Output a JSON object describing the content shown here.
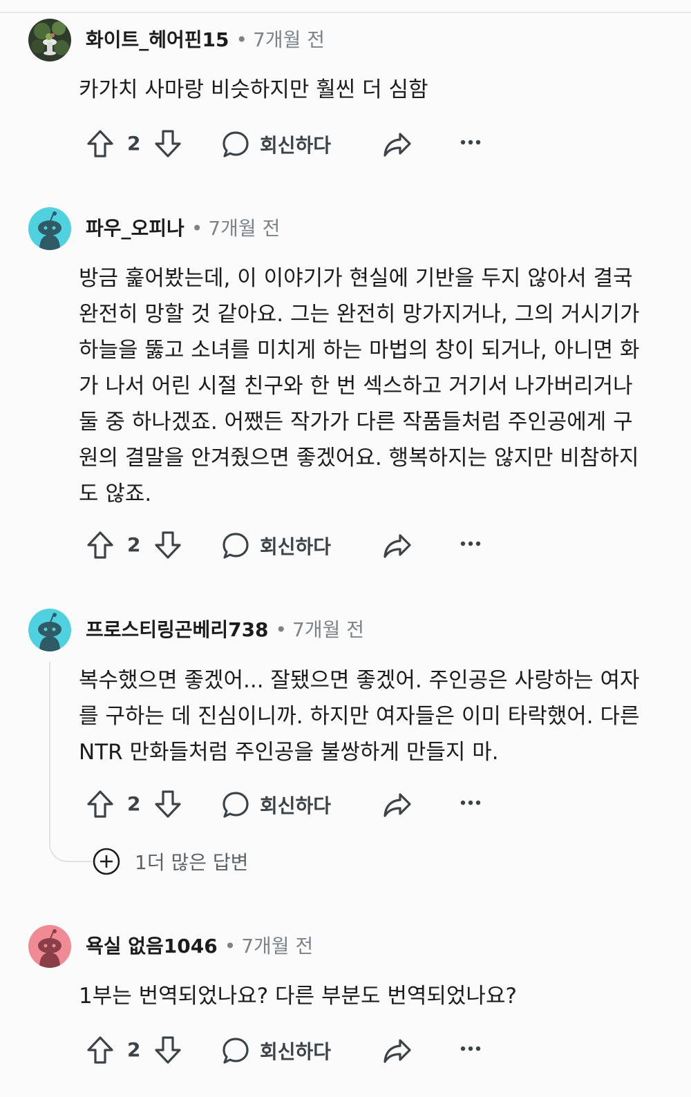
{
  "comments": [
    {
      "username": "화이트_헤어핀15",
      "separator": "•",
      "time": "7개월 전",
      "body": "카가치 사마랑 비슷하지만 훨씬 더 심함",
      "votes": "2",
      "reply_label": "회신하다",
      "avatar_icon": "custom-photo-avatar"
    },
    {
      "username": "파우_오피나",
      "separator": "•",
      "time": "7개월 전",
      "body": "방금 훑어봤는데, 이 이야기가 현실에 기반을 두지 않아서 결국 완전히 망할 것 같아요. 그는 완전히 망가지거나, 그의 거시기가 하늘을 뚫고 소녀를 미치게 하는 마법의 창이 되거나, 아니면 화가 나서 어린 시절 친구와 한 번 섹스하고 거기서 나가버리거나 둘 중 하나겠죠. 어쨌든 작가가 다른 작품들처럼 주인공에게 구원의 결말을 안겨줬으면 좋겠어요. 행복하지는 않지만 비참하지도 않죠.",
      "votes": "2",
      "reply_label": "회신하다",
      "avatar_icon": "snoo-avatar",
      "avatar_color": "#4fd1e0"
    },
    {
      "username": "프로스티링곤베리738",
      "separator": "•",
      "time": "7개월 전",
      "body": "복수했으면 좋겠어... 잘됐으면 좋겠어. 주인공은 사랑하는 여자를 구하는 데 진심이니까. 하지만 여자들은 이미 타락했어. 다른 NTR 만화들처럼 주인공을 불쌍하게 만들지 마.",
      "votes": "2",
      "reply_label": "회신하다",
      "avatar_icon": "snoo-avatar",
      "avatar_color": "#4fd1e0",
      "more_replies": "1더 많은 답변"
    },
    {
      "username": "욕실 없음1046",
      "separator": "•",
      "time": "7개월 전",
      "body": "1부는 번역되었나요? 다른 부분도 번역되었나요?",
      "votes": "2",
      "reply_label": "회신하다",
      "avatar_icon": "snoo-avatar",
      "avatar_color": "#f08a94"
    }
  ],
  "icons": {
    "upvote": "upvote-arrow-icon",
    "downvote": "downvote-arrow-icon",
    "reply": "speech-bubble-icon",
    "share": "share-arrow-icon",
    "more": "ellipsis-icon",
    "expand": "plus-circle-icon"
  }
}
